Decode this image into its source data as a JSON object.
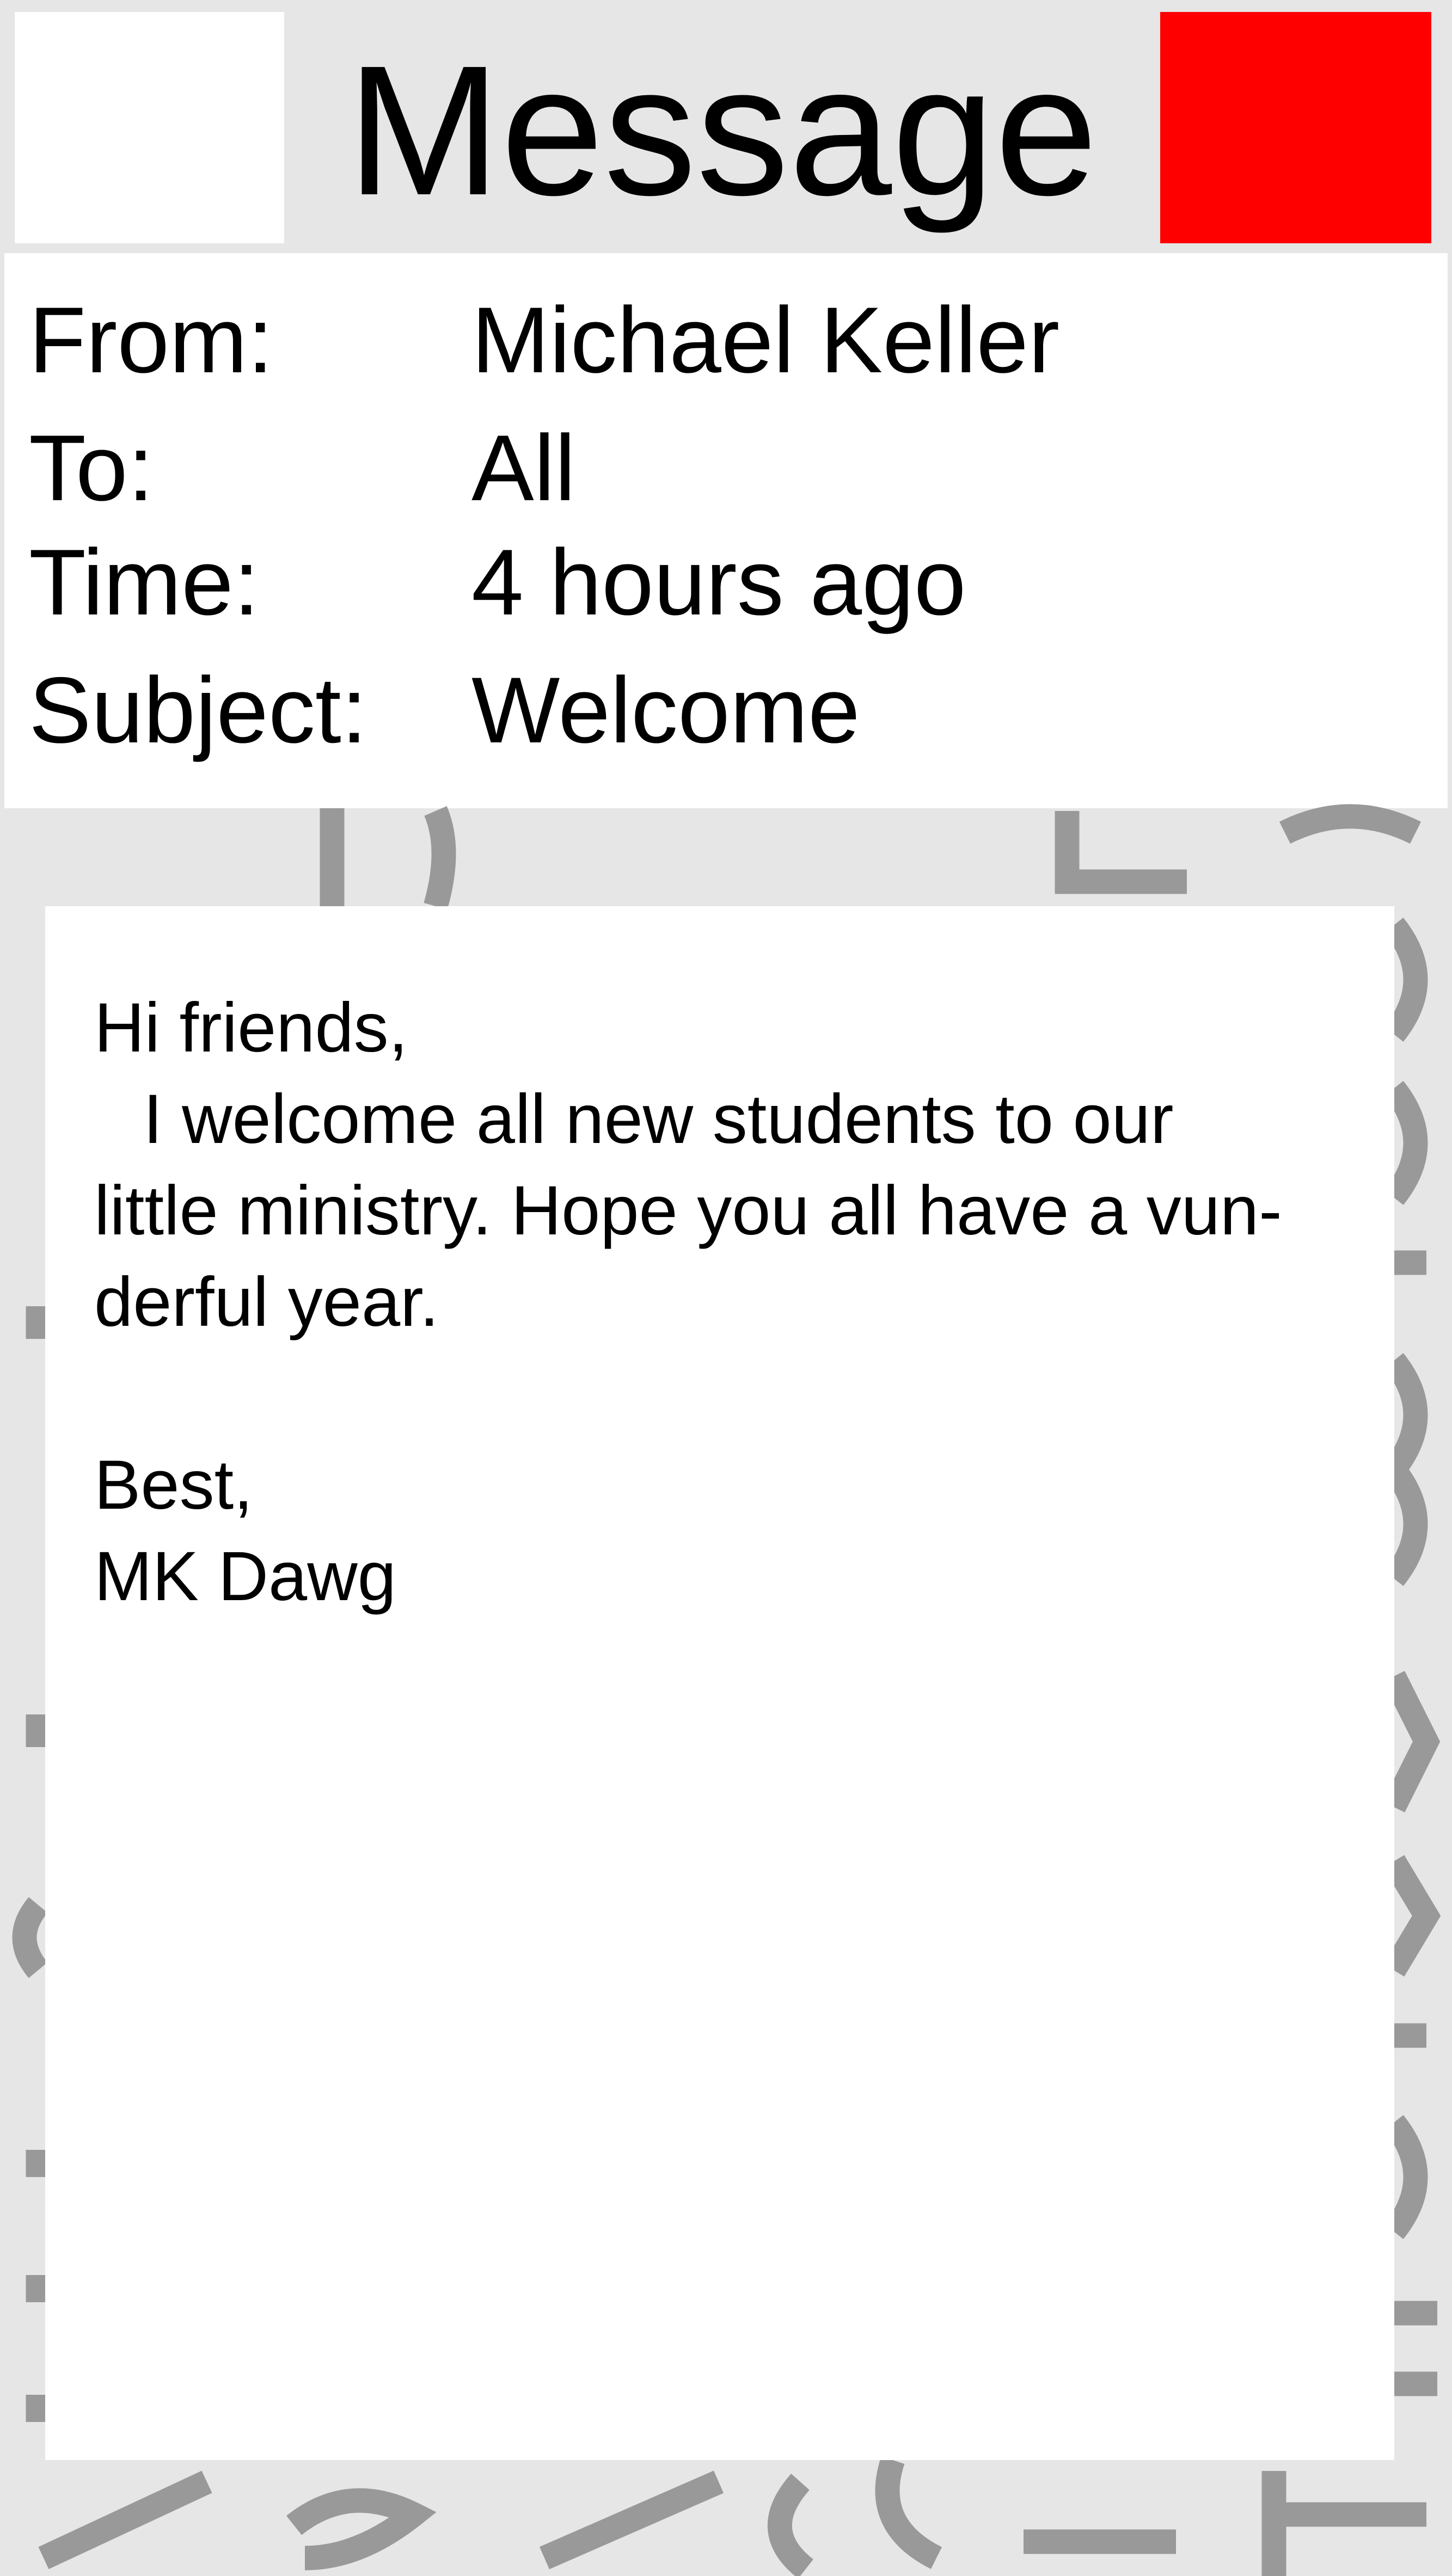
{
  "window": {
    "title": "Message"
  },
  "header": {
    "left_box_label": "",
    "close_color": "#ff0000"
  },
  "meta": {
    "from_label": "From:",
    "from_value": "Michael Keller",
    "to_label": "To:",
    "to_value": "All",
    "time_label": "Time:",
    "time_value": "4 hours ago",
    "subject_label": "Subject:",
    "subject_value": "Welcome"
  },
  "body": {
    "greeting": "Hi friends,",
    "line1": "I welcome all new students to our",
    "line2": "little ministry. Hope you all have a vun-",
    "line3": "derful year.",
    "closing": "Best,",
    "signature": "MK Dawg"
  },
  "colors": {
    "background": "#e6e6e6",
    "panel": "#ffffff",
    "close": "#ff0000",
    "watermark": "#999999"
  }
}
